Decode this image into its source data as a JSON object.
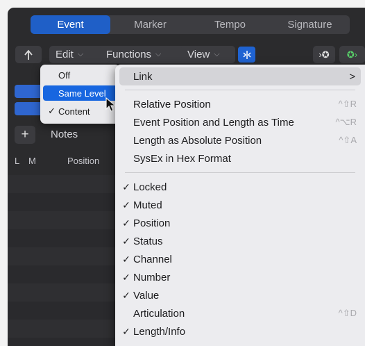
{
  "tabs": [
    {
      "label": "Event",
      "active": true
    },
    {
      "label": "Marker",
      "active": false
    },
    {
      "label": "Tempo",
      "active": false
    },
    {
      "label": "Signature",
      "active": false
    }
  ],
  "toolbar": {
    "back_icon": "up-arrow-icon",
    "edit_label": "Edit",
    "functions_label": "Functions",
    "view_label": "View",
    "catch_icon": "catch-icon",
    "midi_in_icon": "midi-in-icon",
    "midi_out_icon": "midi-out-icon"
  },
  "notes_label": "Notes",
  "plus_label": "+",
  "columns": {
    "l": "L",
    "m": "M",
    "position": "Position"
  },
  "popup": {
    "items": [
      {
        "label": "Off",
        "checked": false,
        "selected": false
      },
      {
        "label": "Same Level",
        "checked": false,
        "selected": true
      },
      {
        "label": "Content",
        "checked": true,
        "selected": false
      }
    ],
    "check_mark": "✓"
  },
  "menu": {
    "link": {
      "label": "Link",
      "arrow": ">"
    },
    "group1": [
      {
        "label": "Relative Position",
        "shortcut": "^⇧R"
      },
      {
        "label": "Event Position and Length as Time",
        "shortcut": "^⌥R"
      },
      {
        "label": "Length as Absolute Position",
        "shortcut": "^⇧A"
      },
      {
        "label": "SysEx in Hex Format",
        "shortcut": ""
      }
    ],
    "group2": [
      {
        "label": "Locked",
        "checked": true,
        "shortcut": ""
      },
      {
        "label": "Muted",
        "checked": true,
        "shortcut": ""
      },
      {
        "label": "Position",
        "checked": true,
        "shortcut": ""
      },
      {
        "label": "Status",
        "checked": true,
        "shortcut": ""
      },
      {
        "label": "Channel",
        "checked": true,
        "shortcut": ""
      },
      {
        "label": "Number",
        "checked": true,
        "shortcut": ""
      },
      {
        "label": "Value",
        "checked": true,
        "shortcut": ""
      },
      {
        "label": "Articulation",
        "checked": false,
        "shortcut": "^⇧D"
      },
      {
        "label": "Length/Info",
        "checked": true,
        "shortcut": ""
      }
    ],
    "check_mark": "✓"
  },
  "colors": {
    "accent": "#1f5fc7",
    "selection": "#1766e0",
    "window_bg": "#2b2b2d"
  }
}
